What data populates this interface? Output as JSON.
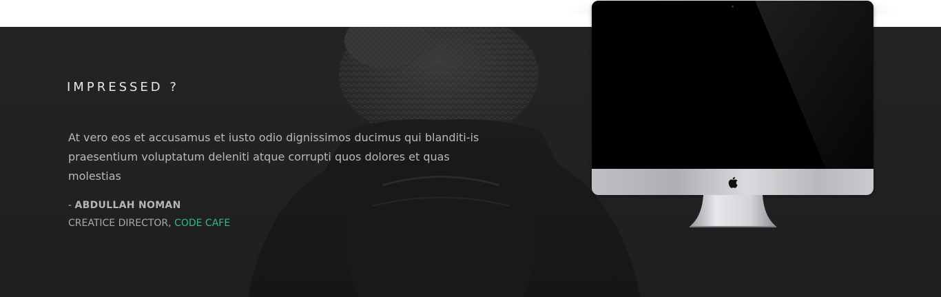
{
  "section": {
    "heading": "IMPRESSED ?",
    "quote": "At vero eos et accusamus et iusto odio dignissimos ducimus qui blanditi-is praesentium voluptatum deleniti atque corrupti quos dolores et quas molestias",
    "author_prefix": "- ",
    "author_name": "ABDULLAH NOMAN",
    "role": "CREATICE DIRECTOR, ",
    "company": "CODE CAFE"
  },
  "colors": {
    "background": "#222222",
    "accent": "#2fb891",
    "heading": "#e8e8e8",
    "body_text": "#b9b9b9"
  },
  "device": {
    "type": "imac",
    "logo_icon": "apple-logo-icon"
  }
}
